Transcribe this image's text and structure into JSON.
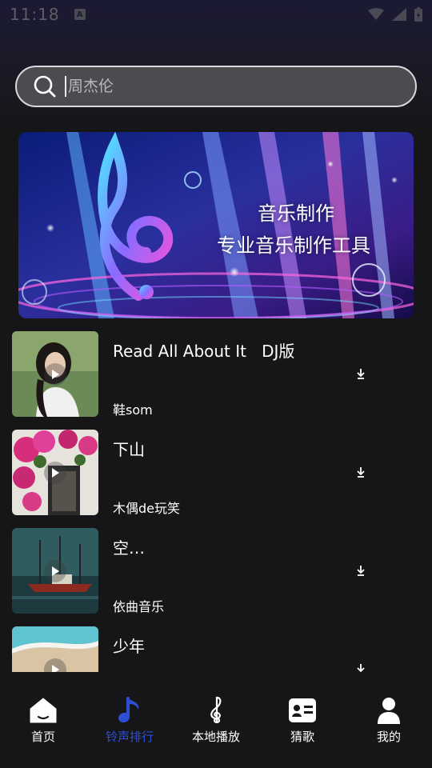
{
  "status_bar": {
    "time": "11:18"
  },
  "search": {
    "placeholder": "周杰伦"
  },
  "banner": {
    "title": "音乐制作",
    "subtitle": "专业音乐制作工具"
  },
  "songs": [
    {
      "title": "Read All About It   DJ版",
      "artist": "鞋som"
    },
    {
      "title": "下山",
      "artist": "木偶de玩笑"
    },
    {
      "title": "空…",
      "artist": "依曲音乐"
    },
    {
      "title": "少年",
      "artist": ""
    }
  ],
  "nav": {
    "items": [
      {
        "label": "首页",
        "icon": "home-icon"
      },
      {
        "label": "铃声排行",
        "icon": "music-note-icon"
      },
      {
        "label": "本地播放",
        "icon": "treble-clef-icon"
      },
      {
        "label": "猜歌",
        "icon": "id-card-icon"
      },
      {
        "label": "我的",
        "icon": "user-icon"
      }
    ],
    "active_index": 1,
    "active_color": "#2f4fd2"
  },
  "colors": {
    "background": "#161618",
    "search_fill": "#4b4b50",
    "accent": "#2f4fd2"
  }
}
